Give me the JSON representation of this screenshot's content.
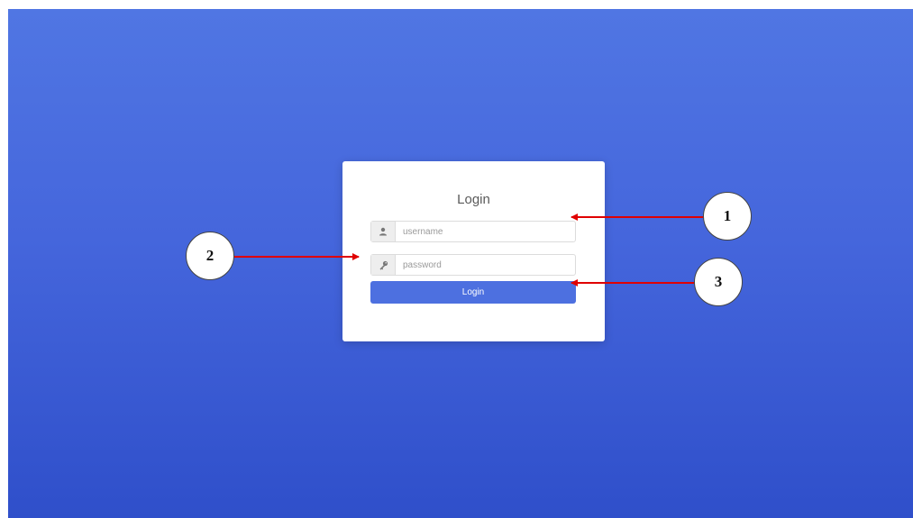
{
  "login": {
    "title": "Login",
    "username_placeholder": "username",
    "password_placeholder": "password",
    "button_label": "Login",
    "button_color": "#4d70e0"
  },
  "annotations": [
    "1",
    "2",
    "3"
  ],
  "colors": {
    "background_top": "#5076e3",
    "background_bottom": "#2f4fca",
    "arrow": "#e00000"
  },
  "icons": {
    "username": "user-icon",
    "password": "key-icon"
  }
}
